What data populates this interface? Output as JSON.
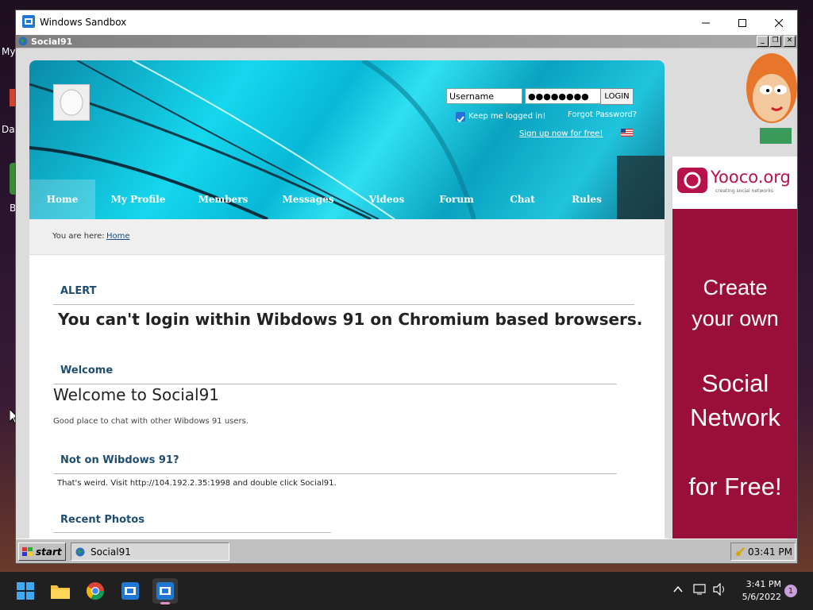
{
  "host": {
    "desktop_icons": [
      "My",
      "Dat",
      "B"
    ],
    "clock_time": "3:41 PM",
    "clock_date": "5/6/2022",
    "notification_count": "1"
  },
  "sandbox": {
    "title": "Windows Sandbox"
  },
  "guest_window": {
    "title": "Social91"
  },
  "site": {
    "login": {
      "username_value": "Username",
      "password_value": "●●●●●●●●",
      "login_button": "LOGIN",
      "keep_logged_in": "Keep me logged in!",
      "forgot_password": "Forgot Password?",
      "signup": "Sign up now for free!"
    },
    "nav": [
      "Home",
      "My Profile",
      "Members",
      "Messages",
      "Videos",
      "Forum",
      "Chat",
      "Rules"
    ],
    "breadcrumb_prefix": "You are here:",
    "breadcrumb_link": "Home",
    "alert_title": "ALERT",
    "alert_text": "You can't login within Wibdows 91 on Chromium based browsers.",
    "welcome_title": "Welcome",
    "welcome_heading": "Welcome to Social91",
    "welcome_text": "Good place to chat with other Wibdows 91 users.",
    "notwib_title": "Not on Wibdows 91?",
    "notwib_text": "That's weird. Visit http://104.192.2.35:1998 and double click Social91.",
    "recent_title": "Recent Photos"
  },
  "ad": {
    "logo_text": "Yooco.org",
    "logo_sub": "creating social networks",
    "line1": "Create",
    "line2": "your own",
    "line3": "Social",
    "line4": "Network",
    "line5": "for Free!"
  },
  "guest_taskbar": {
    "start": "start",
    "task_item": "Social91",
    "tray_time": "03:41 PM"
  },
  "colors": {
    "banner_accent": "#15d7ee",
    "section_heading": "#1f4d70",
    "ad_background": "#9a0f3a",
    "host_taskbar": "#202020"
  }
}
